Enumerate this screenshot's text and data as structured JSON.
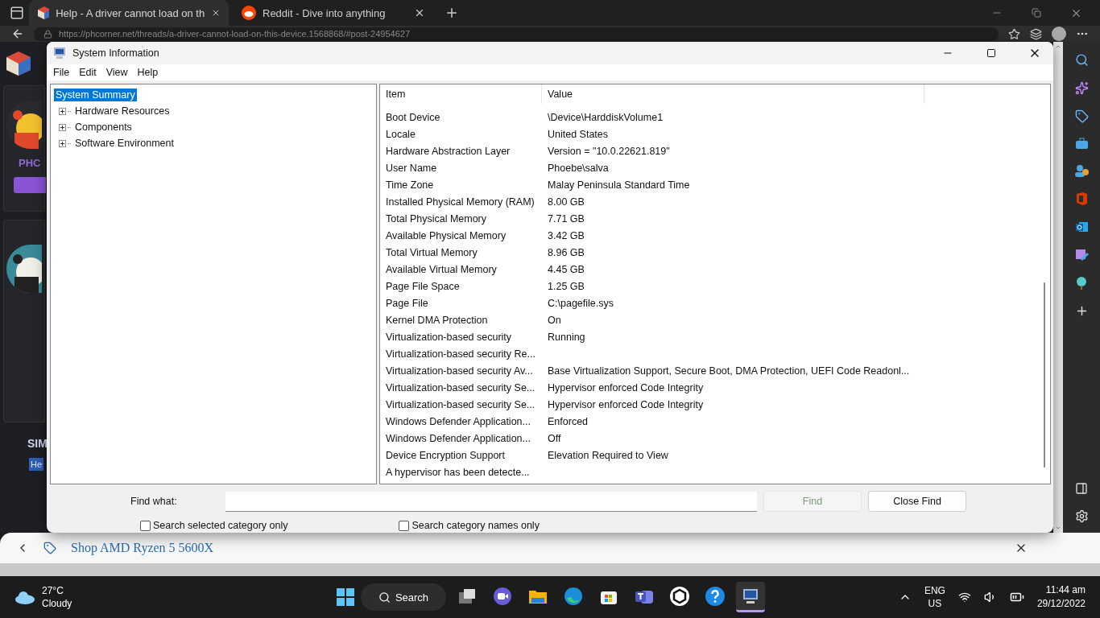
{
  "browser": {
    "tabs": [
      {
        "title": "Help - A driver cannot load on th",
        "selected": true,
        "kind": "forum"
      },
      {
        "title": "Reddit - Dive into anything",
        "selected": false,
        "kind": "reddit"
      }
    ],
    "url": "https://phcorner.net/threads/a-driver-cannot-load-on-this-device.1568868/#post-24954627",
    "page": {
      "username": "PHC",
      "section": "SIM",
      "reply": "He"
    },
    "shopping_bar": {
      "text": "Shop AMD Ryzen 5 5600X"
    }
  },
  "window": {
    "title": "System Information",
    "menu": [
      "File",
      "Edit",
      "View",
      "Help"
    ],
    "tree": [
      {
        "label": "System Summary",
        "selected": true,
        "kind": "leaf"
      },
      {
        "label": "Hardware Resources",
        "selected": false,
        "kind": "folder",
        "expanded": false
      },
      {
        "label": "Components",
        "selected": false,
        "kind": "folder",
        "expanded": false
      },
      {
        "label": "Software Environment",
        "selected": false,
        "kind": "folder",
        "expanded": false
      }
    ],
    "columns": [
      "Item",
      "Value"
    ],
    "rows": [
      {
        "item": "Boot Device",
        "value": "\\Device\\HarddiskVolume1"
      },
      {
        "item": "Locale",
        "value": "United States"
      },
      {
        "item": "Hardware Abstraction Layer",
        "value": "Version = \"10.0.22621.819\""
      },
      {
        "item": "User Name",
        "value": "Phoebe\\salva"
      },
      {
        "item": "Time Zone",
        "value": "Malay Peninsula Standard Time"
      },
      {
        "item": "Installed Physical Memory (RAM)",
        "value": "8.00 GB"
      },
      {
        "item": "Total Physical Memory",
        "value": "7.71 GB"
      },
      {
        "item": "Available Physical Memory",
        "value": "3.42 GB"
      },
      {
        "item": "Total Virtual Memory",
        "value": "8.96 GB"
      },
      {
        "item": "Available Virtual Memory",
        "value": "4.45 GB"
      },
      {
        "item": "Page File Space",
        "value": "1.25 GB"
      },
      {
        "item": "Page File",
        "value": "C:\\pagefile.sys"
      },
      {
        "item": "Kernel DMA Protection",
        "value": "On"
      },
      {
        "item": "Virtualization-based security",
        "value": "Running"
      },
      {
        "item": "Virtualization-based security Re..."
      },
      {
        "item": "Virtualization-based security Av...",
        "value": "Base Virtualization Support, Secure Boot, DMA Protection, UEFI Code Readonl..."
      },
      {
        "item": "Virtualization-based security Se...",
        "value": "Hypervisor enforced Code Integrity"
      },
      {
        "item": "Virtualization-based security Se...",
        "value": "Hypervisor enforced Code Integrity"
      },
      {
        "item": "Windows Defender Application...",
        "value": "Enforced"
      },
      {
        "item": "Windows Defender Application...",
        "value": "Off"
      },
      {
        "item": "Device Encryption Support",
        "value": "Elevation Required to View"
      },
      {
        "item": "A hypervisor has been detecte..."
      }
    ],
    "find": {
      "label": "Find what:",
      "buttons": [
        {
          "label": "Find",
          "disabled": true
        },
        {
          "label": "Close Find",
          "disabled": false
        }
      ],
      "checkboxes": [
        {
          "label": "Search selected category only",
          "checked": false
        },
        {
          "label": "Search category names only",
          "checked": false
        }
      ]
    }
  },
  "taskbar": {
    "weather": {
      "temperature": "27°C",
      "condition": "Cloudy"
    },
    "search": "Search",
    "apps": [
      {
        "kind": "taskview",
        "selected": false
      },
      {
        "kind": "meet",
        "selected": false
      },
      {
        "kind": "files",
        "selected": false
      },
      {
        "kind": "edge",
        "selected": false
      },
      {
        "kind": "store",
        "selected": false
      },
      {
        "kind": "teams",
        "selected": false
      },
      {
        "kind": "hex",
        "selected": false
      },
      {
        "kind": "help",
        "selected": false
      },
      {
        "kind": "sysinfo",
        "selected": true
      }
    ],
    "language": "ENG",
    "region": "US",
    "time": "11:44 am",
    "date": "29/12/2022"
  }
}
